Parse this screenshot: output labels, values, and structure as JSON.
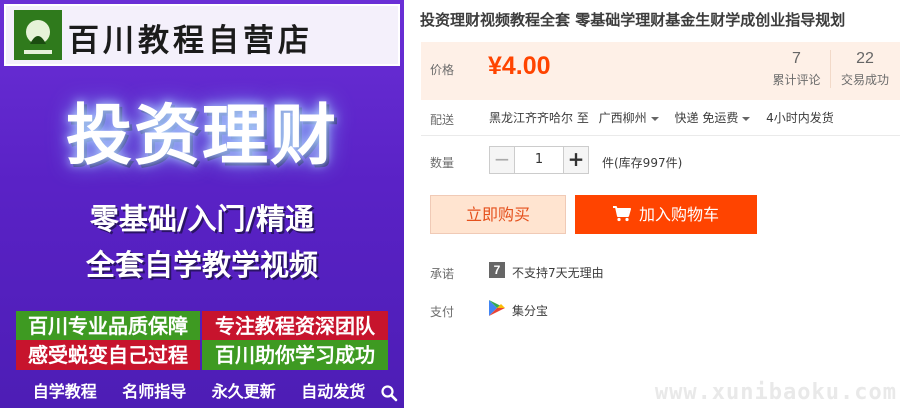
{
  "product_image": {
    "shop_name": "百川教程自营店",
    "big_title": "投资理财",
    "subtitle_1": "零基础/入门/精通",
    "subtitle_2": "全套自学教学视频",
    "tags": [
      "百川专业品质保障",
      "专注教程资深团队",
      "感受蜕变自己过程",
      "百川助你学习成功"
    ],
    "bottom_items": [
      "自学教程",
      "名师指导",
      "永久更新",
      "自动发货"
    ]
  },
  "product": {
    "title": "投资理财视频教程全套 零基础学理财基金生财学成创业指导规划"
  },
  "price": {
    "label": "价格",
    "value": "¥4.00",
    "reviews_count": "7",
    "reviews_label": "累计评论",
    "trades_count": "22",
    "trades_label": "交易成功"
  },
  "shipping": {
    "label": "配送",
    "from": "黑龙江齐齐哈尔 至",
    "to": "广西柳州",
    "method": "快递 免运费",
    "dispatch": "4小时内发货"
  },
  "quantity": {
    "label": "数量",
    "minus": "−",
    "value": "1",
    "plus": "+",
    "stock": "件(库存997件)"
  },
  "actions": {
    "buy_now": "立即购买",
    "add_to_cart": "加入购物车"
  },
  "promise": {
    "label": "承诺",
    "icon_text": "7",
    "text": "不支持7天无理由"
  },
  "payment": {
    "label": "支付",
    "text": "集分宝"
  },
  "watermark": "www.xunibaoku.com",
  "colors": {
    "accent": "#ff4400",
    "price_bg": "#fef0e7",
    "buy_now_bg": "#ffe4d0"
  }
}
